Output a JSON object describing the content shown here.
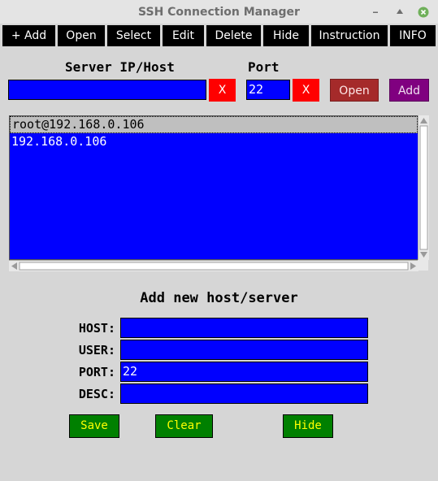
{
  "window": {
    "title": "SSH Connection Manager"
  },
  "menu": {
    "items": [
      "+ Add",
      "Open",
      "Select",
      "Edit",
      "Delete",
      "Hide",
      "Instruction",
      "INFO"
    ]
  },
  "connect": {
    "host_label": "Server IP/Host",
    "host_value": "",
    "host_clear_label": "X",
    "port_label": "Port",
    "port_value": "22",
    "port_clear_label": "X",
    "open_label": "Open",
    "add_label": "Add"
  },
  "host_list": {
    "items": [
      "root@192.168.0.106",
      "192.168.0.106"
    ],
    "selected_index": 0
  },
  "add_form": {
    "title": "Add new host/server",
    "host_label": "HOST:",
    "host_value": "",
    "user_label": "USER:",
    "user_value": "",
    "port_label": "PORT:",
    "port_value": "22",
    "desc_label": "DESC:",
    "desc_value": "",
    "save_label": "Save",
    "clear_label": "Clear",
    "hide_label": "Hide"
  },
  "colors": {
    "entry_bg": "#0000ff",
    "clear_button": "#ff0000",
    "open_button": "#a52a2a",
    "add_button": "#800080",
    "form_buttons": "#008000",
    "form_button_text": "#ffff00",
    "menu_bg": "#000000"
  }
}
